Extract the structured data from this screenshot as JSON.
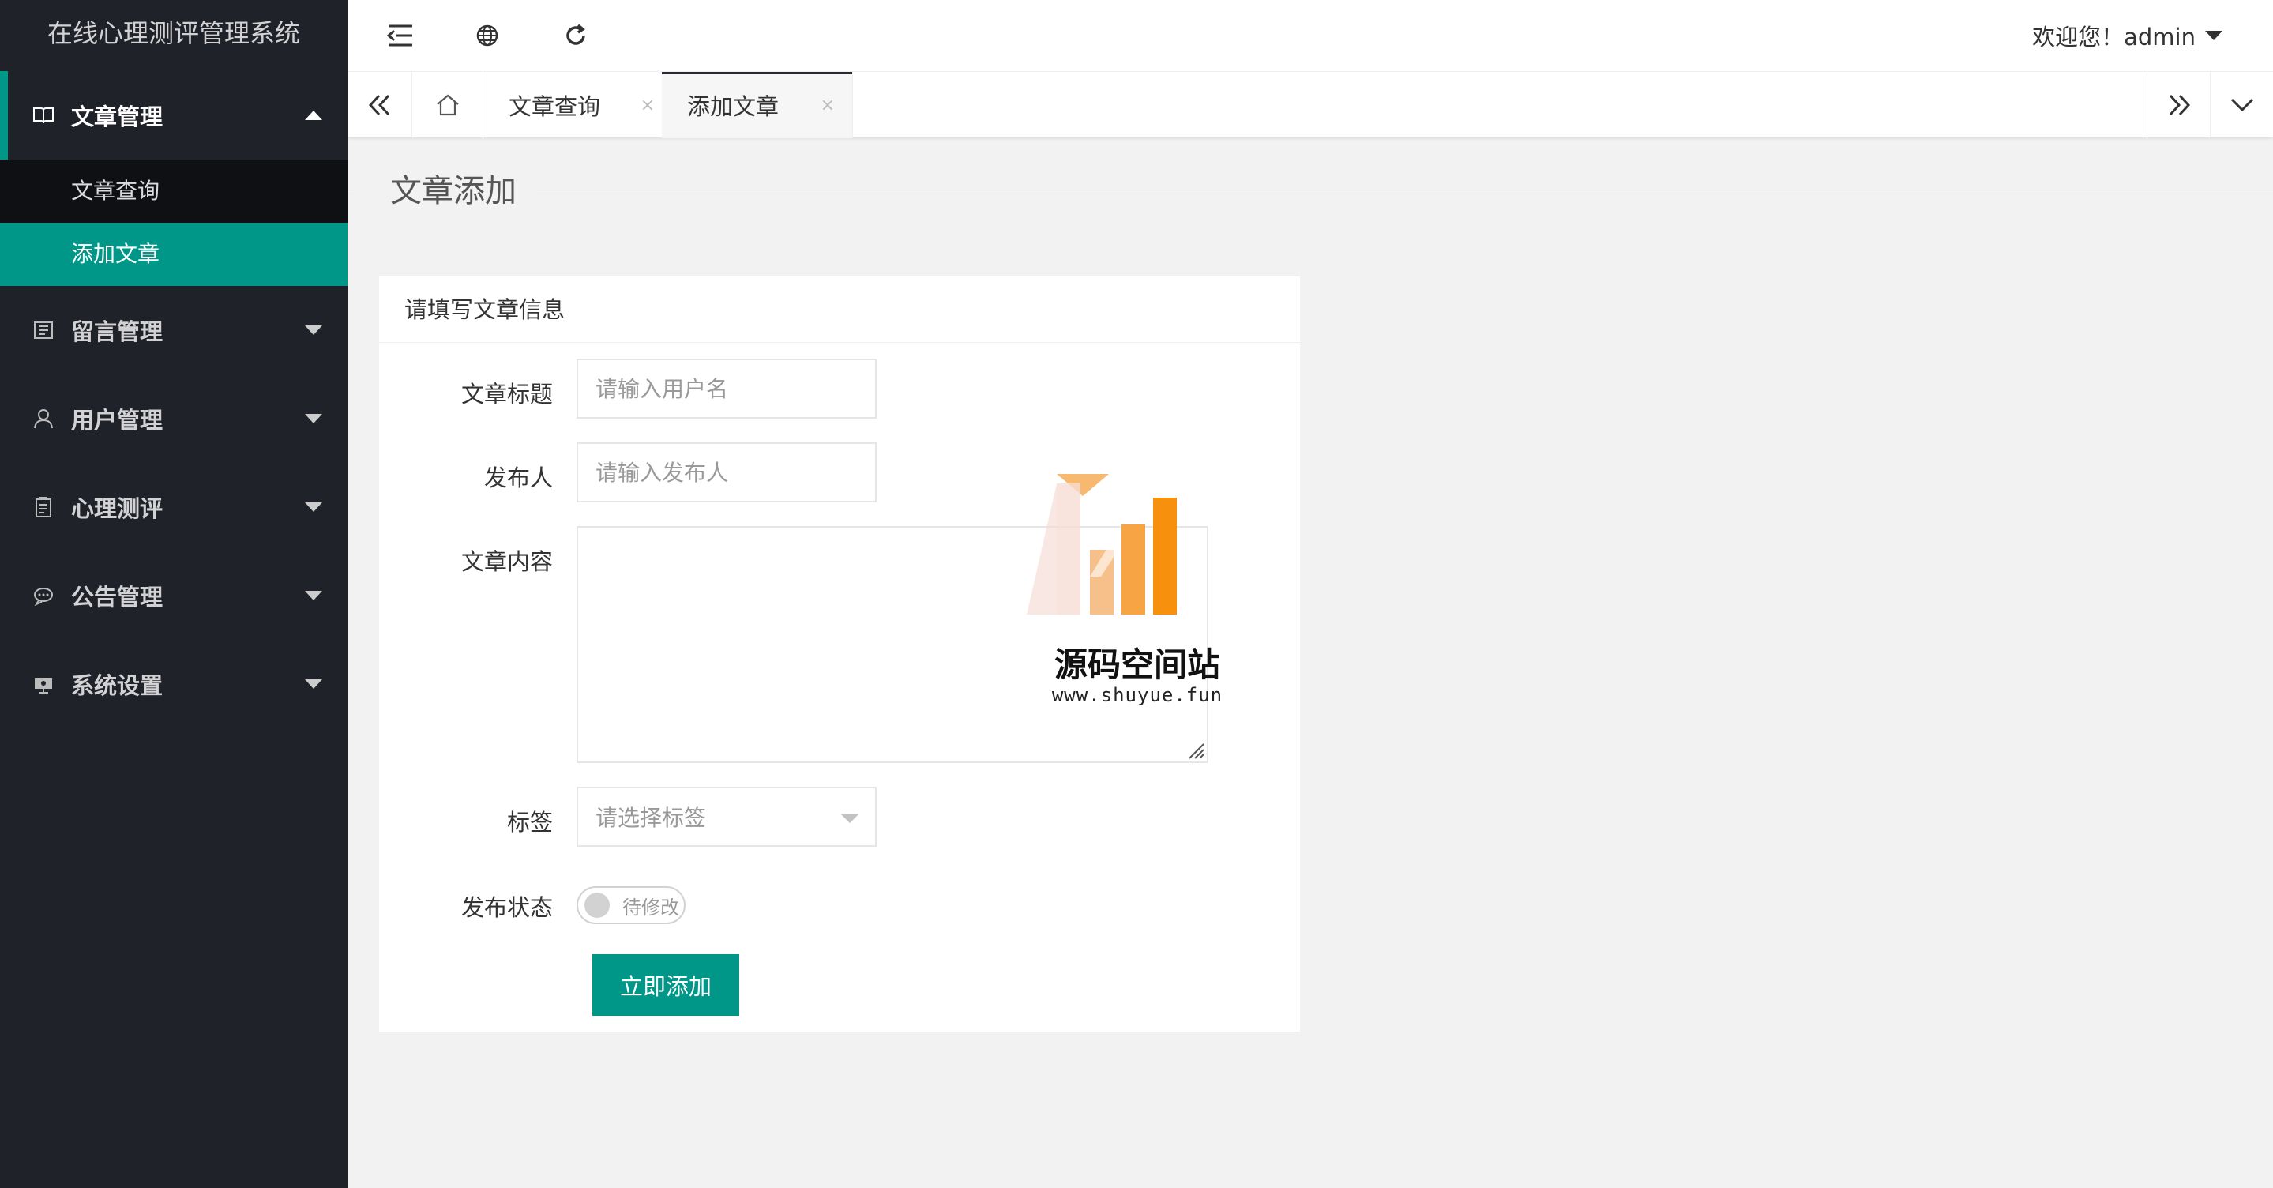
{
  "app": {
    "title": "在线心理测评管理系统"
  },
  "header": {
    "welcome": "欢迎您！admin"
  },
  "sidebar": {
    "groups": [
      {
        "label": "文章管理",
        "icon": "book-icon",
        "expanded": true,
        "items": [
          {
            "label": "文章查询"
          },
          {
            "label": "添加文章"
          }
        ]
      },
      {
        "label": "留言管理",
        "icon": "message-board-icon"
      },
      {
        "label": "用户管理",
        "icon": "user-icon"
      },
      {
        "label": "心理测评",
        "icon": "clipboard-icon"
      },
      {
        "label": "公告管理",
        "icon": "chat-bubble-icon"
      },
      {
        "label": "系统设置",
        "icon": "settings-monitor-icon"
      }
    ]
  },
  "tabs": [
    {
      "label": "文章查询",
      "close": "×"
    },
    {
      "label": "添加文章",
      "close": "×",
      "active": true
    }
  ],
  "page": {
    "title": "文章添加"
  },
  "form": {
    "card_title": "请填写文章信息",
    "title_label": "文章标题",
    "title_placeholder": "请输入用户名",
    "author_label": "发布人",
    "author_placeholder": "请输入发布人",
    "content_label": "文章内容",
    "tag_label": "标签",
    "tag_placeholder": "请选择标签",
    "status_label": "发布状态",
    "status_off_text": "待修改",
    "submit_label": "立即添加"
  },
  "watermark": {
    "name": "源码空间站",
    "url": "www.shuyue.fun"
  },
  "colors": {
    "sidebar_bg": "#20222a",
    "submenu_bg": "#0f1014",
    "accent": "#009688",
    "watermark_orange": "#f7900c"
  }
}
